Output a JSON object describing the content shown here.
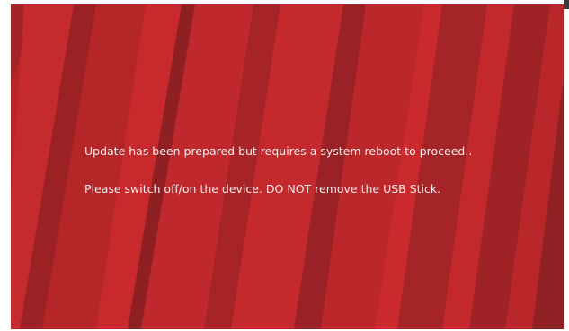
{
  "screen": {
    "background_color": "#b8262a",
    "stripe_colors": [
      "#a82327",
      "#c2282c",
      "#9e2226",
      "#cc2a2e",
      "#8f2024"
    ]
  },
  "messages": {
    "line1": "Update has been prepared but requires a system reboot to proceed..",
    "line2": "Please switch off/on the device. DO NOT remove the USB Stick."
  }
}
